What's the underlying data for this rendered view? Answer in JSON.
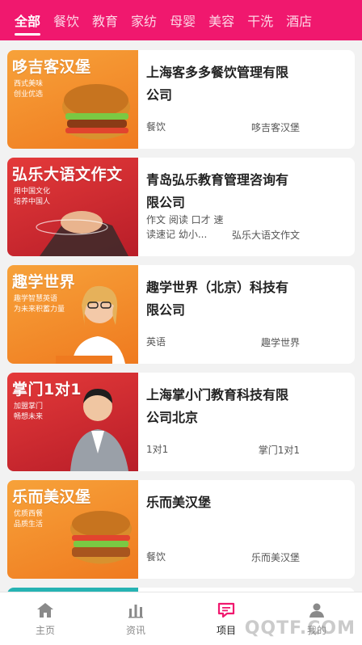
{
  "tabs": [
    "全部",
    "餐饮",
    "教育",
    "家纺",
    "母婴",
    "美容",
    "干洗",
    "酒店"
  ],
  "active_tab": "全部",
  "cards": [
    {
      "thumb_title": "哆吉客汉堡",
      "thumb_sub1": "西式美味",
      "thumb_sub2": "创业优选",
      "company": "上海客多多餐饮管理有限公司",
      "tags": "餐饮",
      "brand": "哆吉客汉堡"
    },
    {
      "thumb_title": "弘乐大语文作文",
      "thumb_sub1": "用中国文化",
      "thumb_sub2": "培养中国人",
      "company": "青岛弘乐教育管理咨询有限公司",
      "tags": "作文 阅读 口才 速读速记 幼小...",
      "brand": "弘乐大语文作文"
    },
    {
      "thumb_title": "趣学世界",
      "thumb_sub1": "趣学智慧英语",
      "thumb_sub2": "为未来积蓄力量",
      "company": "趣学世界（北京）科技有限公司",
      "tags": "英语",
      "brand": "趣学世界"
    },
    {
      "thumb_title": "掌门1对1",
      "thumb_sub1": "加盟掌门",
      "thumb_sub2": "畅想未来",
      "company": "上海掌小门教育科技有限公司北京",
      "tags": "1对1",
      "brand": "掌门1对1"
    },
    {
      "thumb_title": "乐而美汉堡",
      "thumb_sub1": "优质西餐",
      "thumb_sub2": "品质生活",
      "company": "乐而美汉堡",
      "tags": "餐饮",
      "brand": "乐而美汉堡"
    }
  ],
  "nav": [
    {
      "label": "主页",
      "icon": "home-icon"
    },
    {
      "label": "资讯",
      "icon": "bar-chart-icon"
    },
    {
      "label": "项目",
      "icon": "chat-list-icon"
    },
    {
      "label": "我的",
      "icon": "user-icon"
    }
  ],
  "active_nav": "项目",
  "watermark": "QQTF.COM",
  "colors": {
    "brand": "#f0186e",
    "orange": "#ef7a1f",
    "red": "#c8222c"
  }
}
